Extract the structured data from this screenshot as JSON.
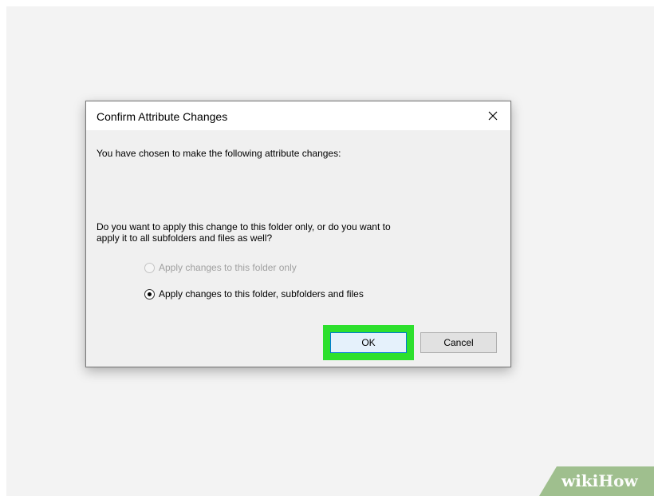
{
  "dialog": {
    "title": "Confirm Attribute Changes",
    "close_icon": "close-icon",
    "intro_text": "You have chosen to make the following attribute changes:",
    "question_line1": "Do you want to apply this change to this folder only, or do you want to",
    "question_line2": "apply it to all subfolders and files as well?",
    "options": [
      {
        "label": "Apply changes to this folder only",
        "selected": false,
        "enabled": false
      },
      {
        "label": "Apply changes to this folder, subfolders and files",
        "selected": true,
        "enabled": true
      }
    ],
    "ok_label": "OK",
    "cancel_label": "Cancel"
  },
  "highlight_color": "#2de02d",
  "watermark": {
    "wiki": "wiki",
    "how": "How",
    "color": "#9fbf8e"
  }
}
